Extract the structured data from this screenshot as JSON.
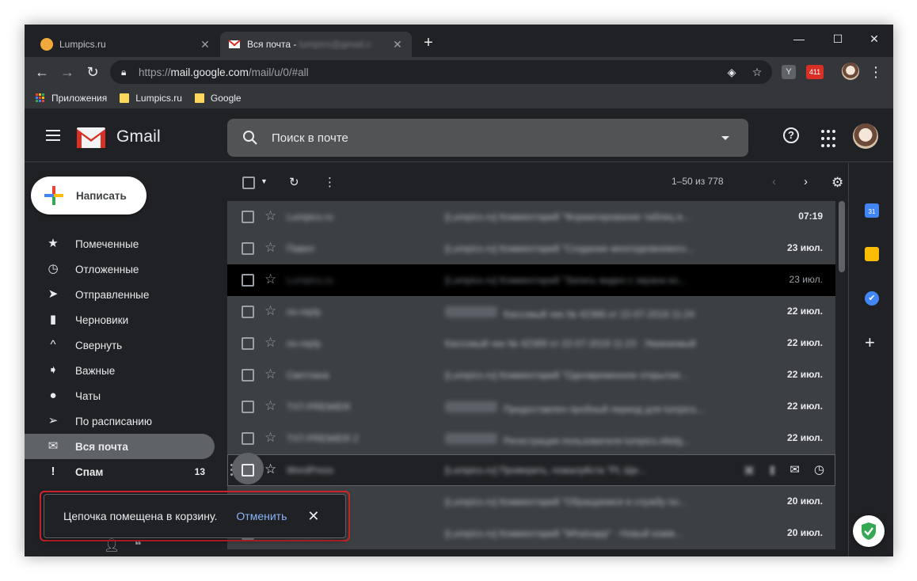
{
  "browser": {
    "tabs": [
      {
        "title": "Lumpics.ru",
        "active": false
      },
      {
        "title": "Вся почта - ",
        "active": true
      }
    ],
    "new_tab": "+",
    "address": {
      "scheme": "https://",
      "host": "mail.google.com",
      "path": "/mail/u/0/#all"
    },
    "bookmarks": [
      "Приложения",
      "Lumpics.ru",
      "Google"
    ],
    "extension_badge": "411"
  },
  "gmail": {
    "brand": "Gmail",
    "search_placeholder": "Поиск в почте",
    "compose_label": "Написать",
    "nav": [
      {
        "label": "Помеченные",
        "icon": "star-icon"
      },
      {
        "label": "Отложенные",
        "icon": "clock-icon"
      },
      {
        "label": "Отправленные",
        "icon": "send-icon"
      },
      {
        "label": "Черновики",
        "icon": "draft-icon"
      },
      {
        "label": "Свернуть",
        "icon": "chevron-up-icon"
      },
      {
        "label": "Важные",
        "icon": "important-icon"
      },
      {
        "label": "Чаты",
        "icon": "chat-icon"
      },
      {
        "label": "По расписанию",
        "icon": "scheduled-icon"
      },
      {
        "label": "Вся почта",
        "icon": "mail-icon",
        "active": true
      },
      {
        "label": "Спам",
        "icon": "spam-icon",
        "count": "13",
        "bold": true
      }
    ],
    "pager": "1–50 из 778",
    "rows": [
      {
        "date": "07:19",
        "state": "unread"
      },
      {
        "date": "23 июл.",
        "state": "unread"
      },
      {
        "date": "23 июл.",
        "state": "hover"
      },
      {
        "date": "22 июл.",
        "state": "unread",
        "tag": true
      },
      {
        "date": "22 июл.",
        "state": "unread"
      },
      {
        "date": "22 июл.",
        "state": "unread"
      },
      {
        "date": "22 июл.",
        "state": "unread",
        "tag": true
      },
      {
        "date": "22 июл.",
        "state": "unread",
        "tag": true
      },
      {
        "date": "",
        "state": "selected"
      },
      {
        "date": "20 июл.",
        "state": "unread"
      },
      {
        "date": "20 июл.",
        "state": "unread"
      }
    ],
    "snackbar": {
      "message": "Цепочка помещена в корзину.",
      "undo": "Отменить"
    }
  },
  "colors": {
    "accent": "#8ab4f8",
    "highlight": "#d6262b",
    "background": "#202124"
  }
}
